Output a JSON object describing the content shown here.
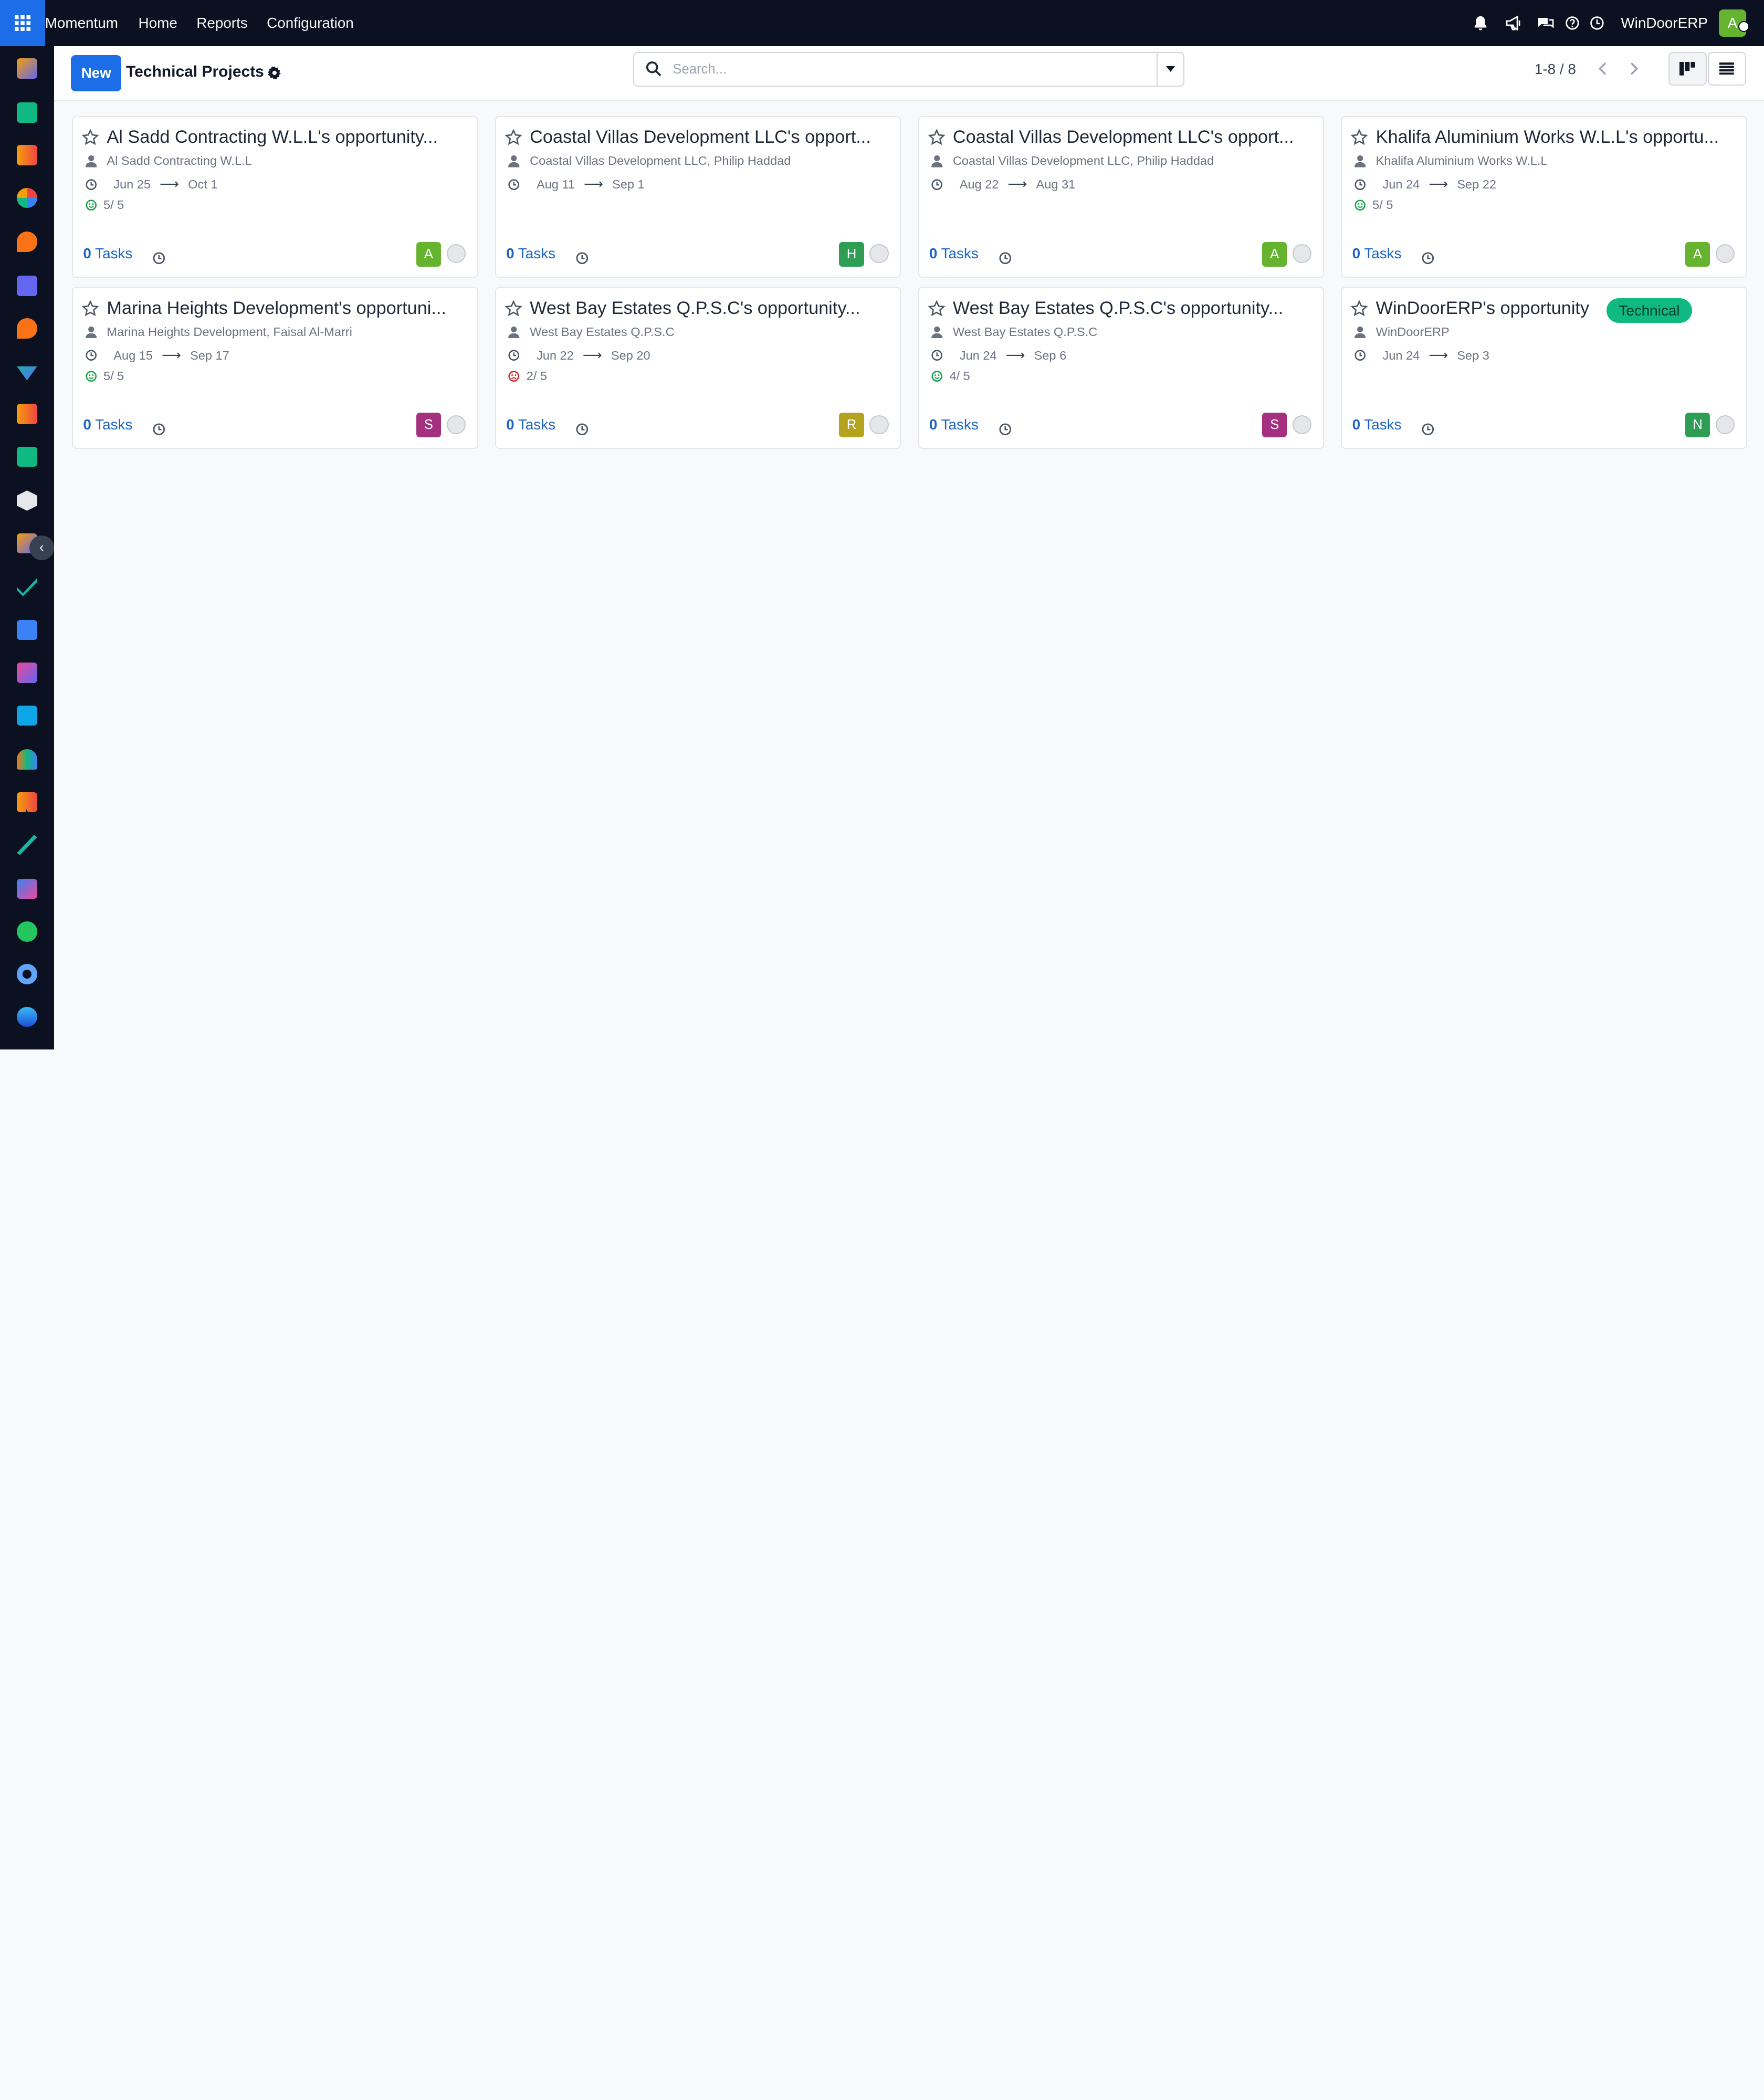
{
  "topbar": {
    "app_name": "Momentum",
    "menu": [
      "Home",
      "Reports",
      "Configuration"
    ],
    "company": "WinDoorERP",
    "user_initial": "A"
  },
  "control": {
    "new_label": "New",
    "title": "Technical Projects",
    "search_placeholder": "Search...",
    "pager": "1-8 / 8"
  },
  "sidebar": {
    "collapse_label": "‹"
  },
  "cards": [
    {
      "title": "Al Sadd Contracting W.L.L's opportunity...",
      "customer": "Al Sadd Contracting W.L.L",
      "date_start": "Jun 25",
      "date_end": "Oct 1",
      "rating": "5/ 5",
      "rating_mood": "good",
      "tasks_count": "0",
      "tasks_label": "Tasks",
      "avatar": "A",
      "avatar_color": "#65b32e"
    },
    {
      "title": "Coastal Villas Development LLC's opport...",
      "customer": "Coastal Villas Development LLC, Philip Haddad",
      "date_start": "Aug 11",
      "date_end": "Sep 1",
      "rating": "",
      "rating_mood": "",
      "tasks_count": "0",
      "tasks_label": "Tasks",
      "avatar": "H",
      "avatar_color": "#2f9e55"
    },
    {
      "title": "Coastal Villas Development LLC's opport...",
      "customer": "Coastal Villas Development LLC, Philip Haddad",
      "date_start": "Aug 22",
      "date_end": "Aug 31",
      "rating": "",
      "rating_mood": "",
      "tasks_count": "0",
      "tasks_label": "Tasks",
      "avatar": "A",
      "avatar_color": "#65b32e"
    },
    {
      "title": "Khalifa Aluminium Works W.L.L's opportu...",
      "customer": "Khalifa Aluminium Works W.L.L",
      "date_start": "Jun 24",
      "date_end": "Sep 22",
      "rating": "5/ 5",
      "rating_mood": "good",
      "tasks_count": "0",
      "tasks_label": "Tasks",
      "avatar": "A",
      "avatar_color": "#65b32e"
    },
    {
      "title": "Marina Heights Development's opportuni...",
      "customer": "Marina Heights Development, Faisal Al-Marri",
      "date_start": "Aug 15",
      "date_end": "Sep 17",
      "rating": "5/ 5",
      "rating_mood": "good",
      "tasks_count": "0",
      "tasks_label": "Tasks",
      "avatar": "S",
      "avatar_color": "#a4307f"
    },
    {
      "title": "West Bay Estates Q.P.S.C's opportunity...",
      "customer": "West Bay Estates Q.P.S.C",
      "date_start": "Jun 22",
      "date_end": "Sep 20",
      "rating": "2/ 5",
      "rating_mood": "bad",
      "tasks_count": "0",
      "tasks_label": "Tasks",
      "avatar": "R",
      "avatar_color": "#b5a31f"
    },
    {
      "title": "West Bay Estates Q.P.S.C's opportunity...",
      "customer": "West Bay Estates Q.P.S.C",
      "date_start": "Jun 24",
      "date_end": "Sep 6",
      "rating": "4/ 5",
      "rating_mood": "good",
      "tasks_count": "0",
      "tasks_label": "Tasks",
      "avatar": "S",
      "avatar_color": "#a4307f"
    },
    {
      "title": "WinDoorERP's opportunity",
      "tag": "Technical",
      "customer": "WinDoorERP",
      "date_start": "Jun 24",
      "date_end": "Sep 3",
      "rating": "",
      "rating_mood": "",
      "tasks_count": "0",
      "tasks_label": "Tasks",
      "avatar": "N",
      "avatar_color": "#2f9e55"
    }
  ],
  "colors": {
    "topbar_bg": "#0b1120",
    "accent": "#1b6ee8",
    "tag_green": "#10b981",
    "link_blue": "#1b64c4"
  }
}
